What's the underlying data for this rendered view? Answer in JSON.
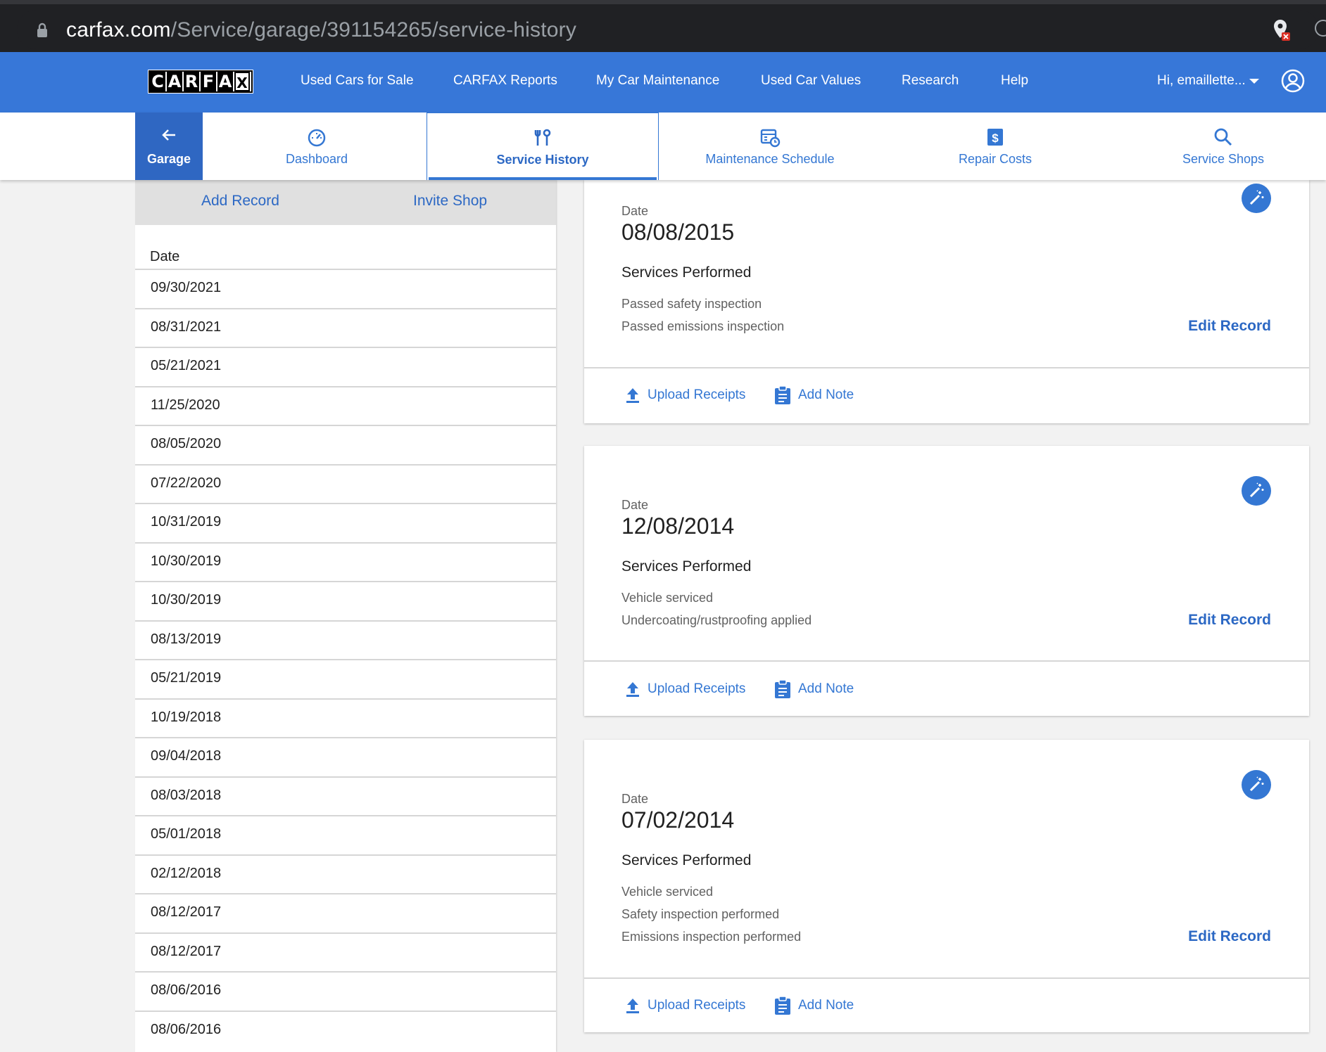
{
  "browser": {
    "url_host": "carfax.com",
    "url_path": "/Service/garage/391154265/service-history"
  },
  "topnav": {
    "logo_text": "CARFAX",
    "links": [
      "Used Cars for Sale",
      "CARFAX Reports",
      "My Car Maintenance",
      "Used Car Values",
      "Research",
      "Help"
    ],
    "user_label": "Hi, emaillette..."
  },
  "subnav": {
    "garage_label": "Garage",
    "tabs": [
      {
        "label": "Dashboard",
        "icon": "speedometer-icon"
      },
      {
        "label": "Service History",
        "icon": "tools-icon",
        "active": true
      },
      {
        "label": "Maintenance Schedule",
        "icon": "calendar-clock-icon"
      },
      {
        "label": "Repair Costs",
        "icon": "dollar-icon"
      },
      {
        "label": "Service Shops",
        "icon": "search-icon"
      }
    ]
  },
  "left": {
    "add_record": "Add Record",
    "invite_shop": "Invite Shop",
    "date_header": "Date",
    "dates": [
      "09/30/2021",
      "08/31/2021",
      "05/21/2021",
      "11/25/2020",
      "08/05/2020",
      "07/22/2020",
      "10/31/2019",
      "10/30/2019",
      "10/30/2019",
      "08/13/2019",
      "05/21/2019",
      "10/19/2018",
      "09/04/2018",
      "08/03/2018",
      "05/01/2018",
      "02/12/2018",
      "08/12/2017",
      "08/12/2017",
      "08/06/2016",
      "08/06/2016"
    ]
  },
  "records": [
    {
      "date_label": "Date",
      "date": "08/08/2015",
      "services_label": "Services Performed",
      "services": [
        "Passed safety inspection",
        "Passed emissions inspection"
      ],
      "edit_label": "Edit Record",
      "upload_label": "Upload Receipts",
      "note_label": "Add Note"
    },
    {
      "date_label": "Date",
      "date": "12/08/2014",
      "services_label": "Services Performed",
      "services": [
        "Vehicle serviced",
        "Undercoating/rustproofing applied"
      ],
      "edit_label": "Edit Record",
      "upload_label": "Upload Receipts",
      "note_label": "Add Note"
    },
    {
      "date_label": "Date",
      "date": "07/02/2014",
      "services_label": "Services Performed",
      "services": [
        "Vehicle serviced",
        "Safety inspection performed",
        "Emissions inspection performed"
      ],
      "edit_label": "Edit Record",
      "upload_label": "Upload Receipts",
      "note_label": "Add Note"
    }
  ],
  "colors": {
    "brand_blue": "#3777d8",
    "link_blue": "#3477d3",
    "garage_blue": "#2f67c2"
  }
}
